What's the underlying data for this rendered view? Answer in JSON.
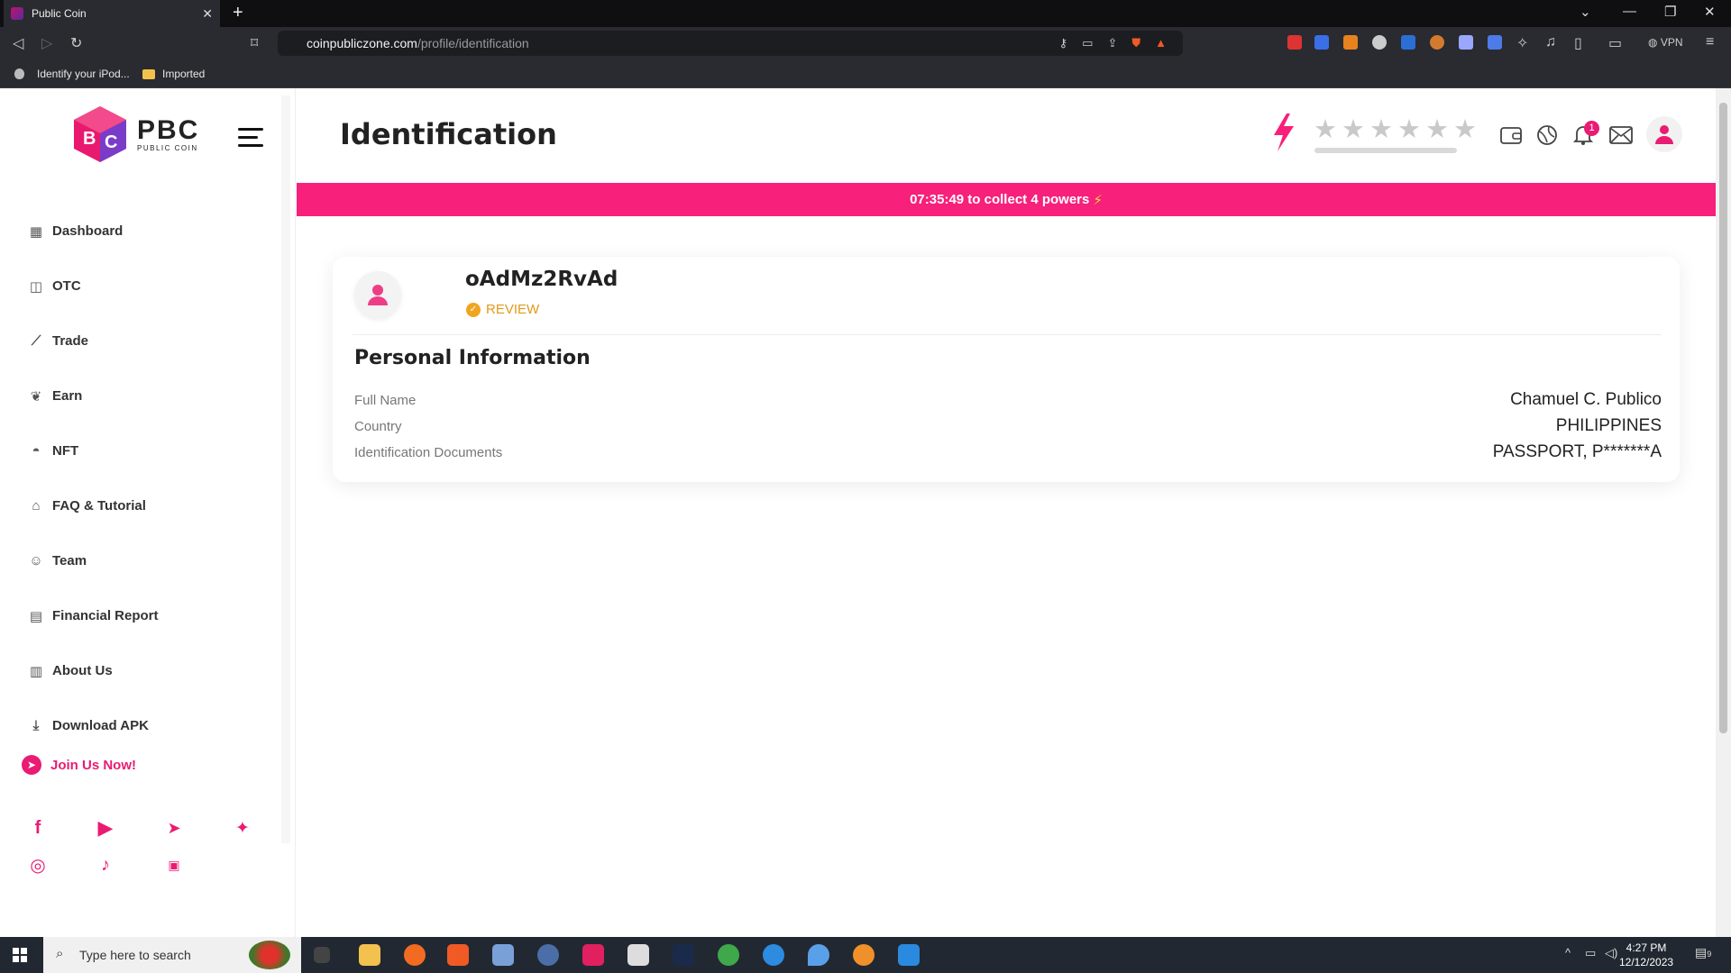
{
  "browser": {
    "tab_title": "Public Coin",
    "url_domain": "coinpubliczone.com",
    "url_path": "/profile/identification",
    "vpn_label": "VPN",
    "bookmarks": [
      "Identify your iPod...",
      "Imported"
    ]
  },
  "sidebar": {
    "logo_text": "PBC",
    "logo_subtext": "PUBLIC COIN",
    "items": [
      {
        "label": "Dashboard",
        "icon": "grid-icon"
      },
      {
        "label": "OTC",
        "icon": "chart-icon"
      },
      {
        "label": "Trade",
        "icon": "trade-icon"
      },
      {
        "label": "Earn",
        "icon": "earn-icon"
      },
      {
        "label": "NFT",
        "icon": "bag-icon"
      },
      {
        "label": "FAQ & Tutorial",
        "icon": "hat-icon"
      },
      {
        "label": "Team",
        "icon": "team-icon"
      },
      {
        "label": "Financial Report",
        "icon": "report-icon"
      },
      {
        "label": "About Us",
        "icon": "document-icon"
      },
      {
        "label": "Download APK",
        "icon": "download-icon"
      }
    ],
    "join_label": "Join Us Now!",
    "social": [
      "facebook-icon",
      "youtube-icon",
      "telegram-icon",
      "twitter-icon",
      "instagram-icon",
      "tiktok-icon",
      "exchange-icon"
    ]
  },
  "header": {
    "title": "Identification",
    "stars_total": 6,
    "stars_filled": 0,
    "notification_count": "1"
  },
  "banner": {
    "text": "07:35:49 to collect 4 powers"
  },
  "profile": {
    "username": "oAdMz2RvAd",
    "status": "REVIEW",
    "section_title": "Personal Information",
    "rows": [
      {
        "label": "Full Name",
        "value": "Chamuel C. Publico"
      },
      {
        "label": "Country",
        "value": "PHILIPPINES"
      },
      {
        "label": "Identification Documents",
        "value": "PASSPORT, P*******A"
      }
    ]
  },
  "taskbar": {
    "search_placeholder": "Type here to search",
    "time": "4:27 PM",
    "date": "12/12/2023",
    "notification_count": "9"
  },
  "colors": {
    "accent": "#f7207a",
    "review": "#e29a1b",
    "chrome_bg": "#2a2b30"
  }
}
